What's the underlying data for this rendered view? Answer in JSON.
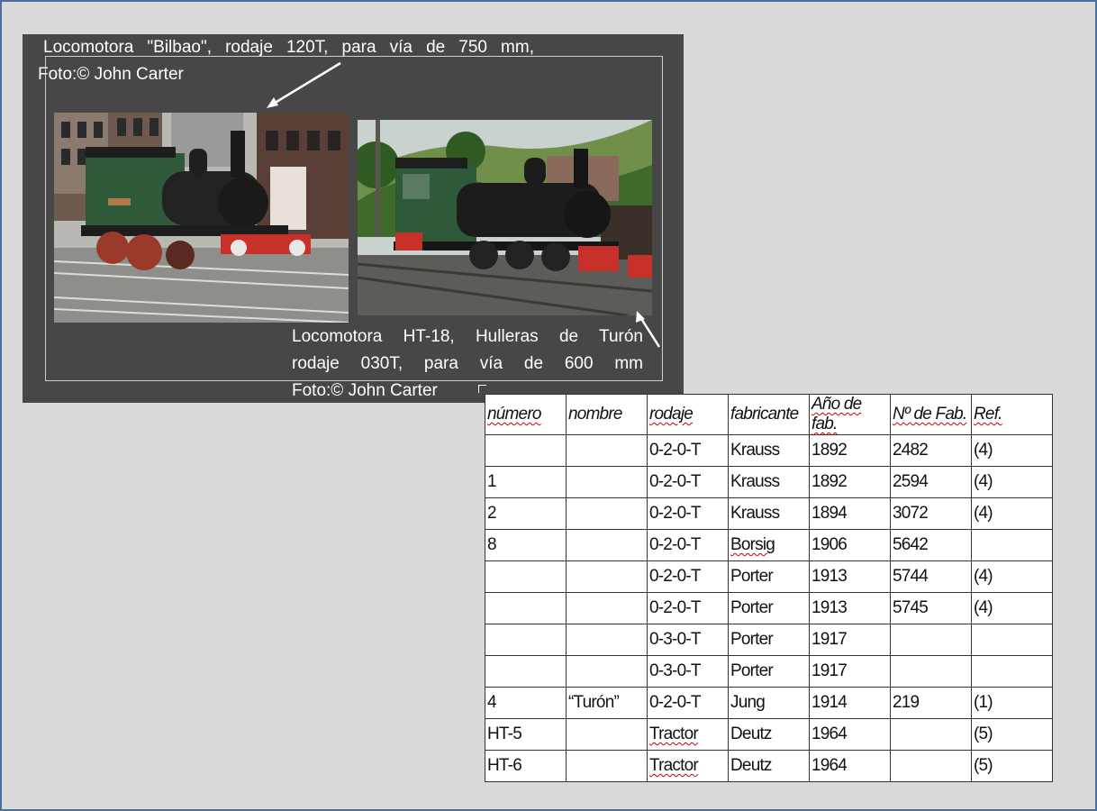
{
  "captions": {
    "top_line1": "Locomotora \"Bilbao\", rodaje 120T, para vía de 750 mm,",
    "top_line2": "Foto:© John Carter",
    "bottom_line1": "Locomotora HT-18, Hulleras de Turón",
    "bottom_line2": "rodaje 030T, para vía de 600 mm",
    "bottom_line3": "Foto:© John Carter"
  },
  "photos": [
    {
      "subject": "green tank locomotive Bilbao in yard"
    },
    {
      "subject": "green tank locomotive HT-18 on tracks"
    }
  ],
  "table": {
    "headers": [
      "número",
      "nombre",
      "rodaje",
      "fabricante",
      "Año de fab.",
      "Nº de Fab.",
      "Ref."
    ],
    "rows": [
      [
        "",
        "",
        "0-2-0-T",
        "Krauss",
        "1892",
        "2482",
        "(4)"
      ],
      [
        "1",
        "",
        "0-2-0-T",
        "Krauss",
        "1892",
        "2594",
        "(4)"
      ],
      [
        "2",
        "",
        "0-2-0-T",
        "Krauss",
        "1894",
        "3072",
        "(4)"
      ],
      [
        "8",
        "",
        "0-2-0-T",
        "Borsig",
        "1906",
        "5642",
        ""
      ],
      [
        "",
        "",
        "0-2-0-T",
        "Porter",
        "1913",
        "5744",
        "(4)"
      ],
      [
        "",
        "",
        "0-2-0-T",
        "Porter",
        "1913",
        "5745",
        "(4)"
      ],
      [
        "",
        "",
        "0-3-0-T",
        "Porter",
        "1917",
        "",
        ""
      ],
      [
        "",
        "",
        "0-3-0-T",
        "Porter",
        "1917",
        "",
        ""
      ],
      [
        "4",
        "“Turón”",
        "0-2-0-T",
        "Jung",
        "1914",
        "219",
        "(1)"
      ],
      [
        "HT-5",
        "",
        "Tractor",
        "Deutz",
        "1964",
        "",
        "(5)"
      ],
      [
        "HT-6",
        "",
        "Tractor",
        "Deutz",
        "1964",
        "",
        "(5)"
      ]
    ]
  },
  "colors": {
    "background": "#d9d9d9",
    "panel": "#474747",
    "border": "#4a6f9c",
    "loco_green": "#2f5a3a",
    "buffer_red": "#c8312a"
  }
}
